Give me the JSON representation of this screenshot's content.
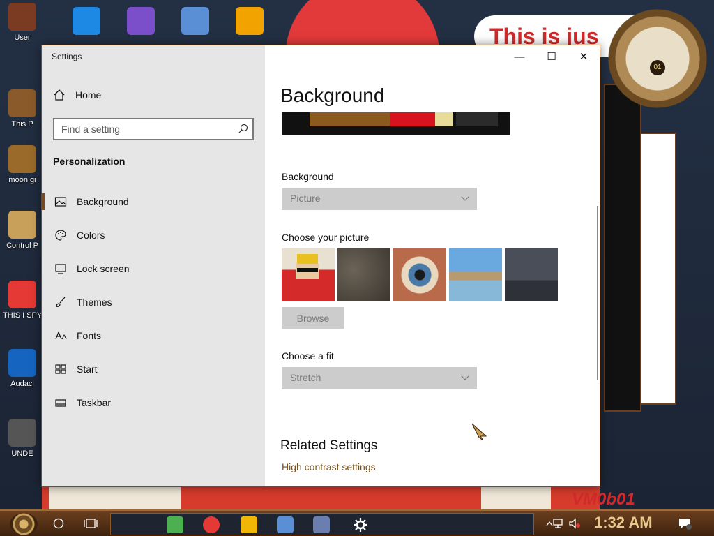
{
  "desktop": {
    "icons": [
      {
        "label": "User",
        "color": "#7a3b22"
      },
      {
        "label": "This P",
        "color": "#8a5a2a"
      },
      {
        "label": "moon gi",
        "color": "#9a6a2a"
      },
      {
        "label": "Control P",
        "color": "#c9a05a"
      },
      {
        "label": "THIS I SPY WA",
        "color": "#e53935"
      },
      {
        "label": "Audaci",
        "color": "#1565c0"
      },
      {
        "label": "UNDE",
        "color": "#555555"
      }
    ],
    "top_icons": [
      {
        "label": "",
        "color": "#1e88e5"
      },
      {
        "label": "",
        "color": "#7b4fc9"
      },
      {
        "label": "",
        "color": "#5a8fd6"
      },
      {
        "label": "",
        "color": "#f2a300"
      }
    ],
    "banner_text": "This is jus",
    "clock_number": "01",
    "corner_text": "VM0b01"
  },
  "window": {
    "title": "Settings",
    "controls": {
      "minimize": "—",
      "maximize": "☐",
      "close": "✕"
    }
  },
  "sidebar": {
    "home_label": "Home",
    "search": {
      "placeholder": "Find a setting",
      "value": ""
    },
    "section_title": "Personalization",
    "items": [
      {
        "label": "Background",
        "icon": "picture-icon",
        "active": true
      },
      {
        "label": "Colors",
        "icon": "palette-icon",
        "active": false
      },
      {
        "label": "Lock screen",
        "icon": "lock-screen-icon",
        "active": false
      },
      {
        "label": "Themes",
        "icon": "brush-icon",
        "active": false
      },
      {
        "label": "Fonts",
        "icon": "font-icon",
        "active": false
      },
      {
        "label": "Start",
        "icon": "start-tiles-icon",
        "active": false
      },
      {
        "label": "Taskbar",
        "icon": "taskbar-icon",
        "active": false
      }
    ]
  },
  "main": {
    "title": "Background",
    "background_label": "Background",
    "background_value": "Picture",
    "choose_picture_label": "Choose your picture",
    "thumbnails": [
      "cartoon-character",
      "robot-figure",
      "eye-closeup",
      "beach-rocks",
      "night-sky"
    ],
    "browse_label": "Browse",
    "choose_fit_label": "Choose a fit",
    "fit_value": "Stretch",
    "related_title": "Related Settings",
    "related_link": "High contrast settings"
  },
  "taskbar": {
    "time": "1:32 AM",
    "apps": [
      "notes-app",
      "chrome",
      "file-explorer",
      "virtualbox",
      "windows95",
      "settings"
    ],
    "colors": {
      "accent": "#7a4a1f",
      "link": "#7a5218"
    }
  }
}
